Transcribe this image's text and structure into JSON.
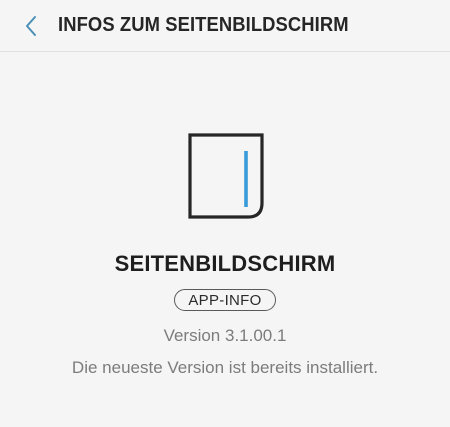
{
  "header": {
    "title": "INFOS ZUM SEITENBILDSCHIRM",
    "back_icon": "chevron-left-icon"
  },
  "app": {
    "icon": "edge-screen-icon",
    "name": "SEITENBILDSCHIRM",
    "info_button_label": "APP-INFO",
    "version": "Version 3.1.00.1",
    "status": "Die neueste Version ist bereits installiert."
  },
  "colors": {
    "accent": "#3a9bd9",
    "background": "#f5f5f5",
    "back_icon": "#4a8fb5"
  }
}
